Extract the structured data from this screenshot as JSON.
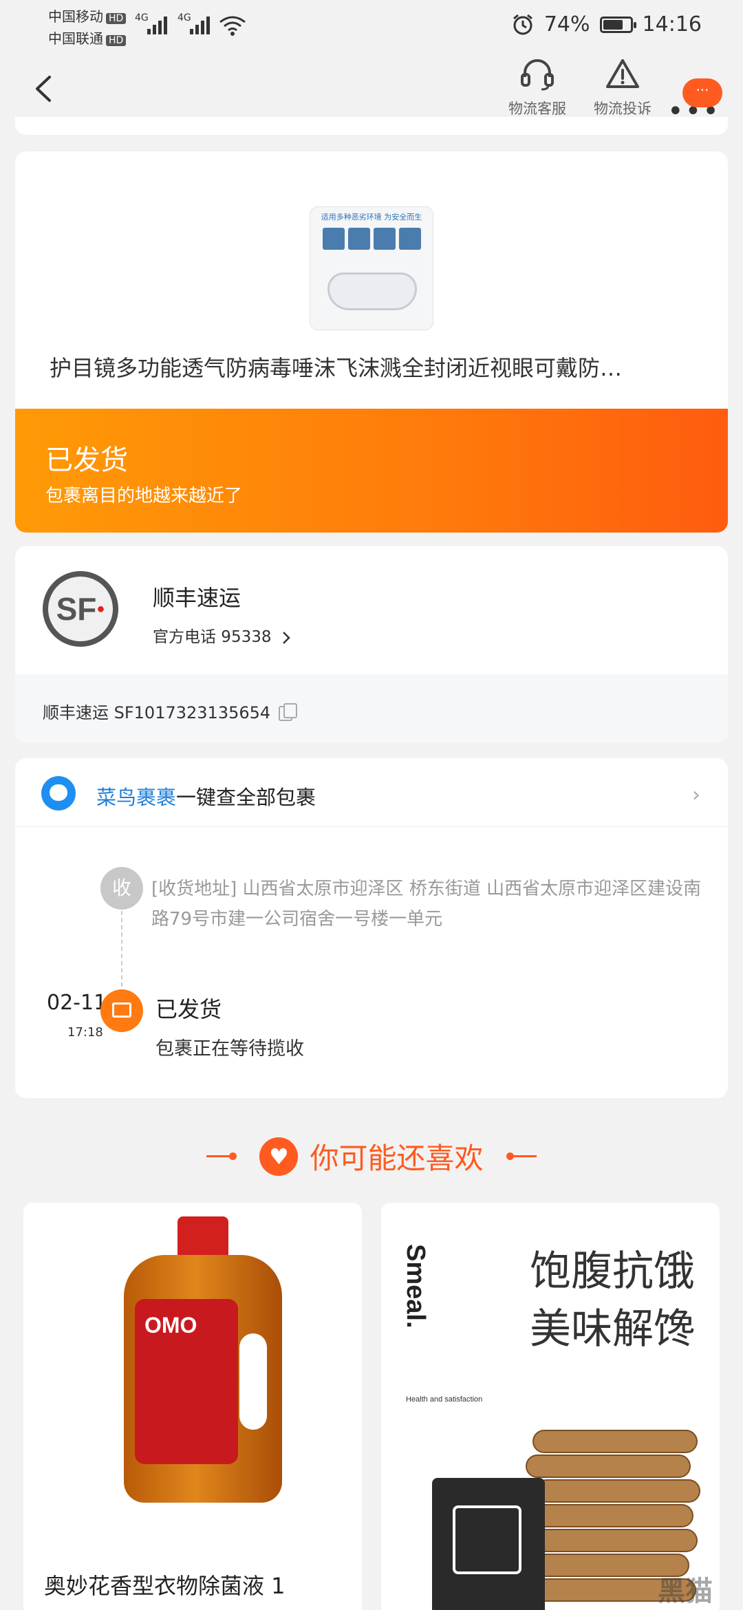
{
  "status_bar": {
    "carrier1": "中国移动",
    "carrier2": "中国联通",
    "hd": "HD",
    "network": "4G",
    "battery_text": "74%",
    "battery_level": 0.74,
    "time": "14:16"
  },
  "nav": {
    "service_label": "物流客服",
    "complaint_label": "物流投诉",
    "more_badge": "···"
  },
  "product": {
    "title": "护目镜多功能透气防病毒唾沫飞沫溅全封闭近视眼可戴防…",
    "image_banner": "适用多种恶劣环境 为安全而生"
  },
  "status": {
    "title": "已发货",
    "subtitle": "包裹离目的地越来越近了"
  },
  "courier": {
    "logo_text": "SF",
    "name": "顺丰速运",
    "phone_label": "官方电话 95338",
    "tracking_label": "顺丰速运 SF1017323135654"
  },
  "cainiao": {
    "brand": "菜鸟裹裹",
    "text": "一键查全部包裹",
    "chevron": "›"
  },
  "timeline": {
    "recv_icon": "收",
    "address": "[收货地址] 山西省太原市迎泽区 桥东街道 山西省太原市迎泽区建设南路79号市建一公司宿舍一号楼一单元",
    "event_date": "02-11",
    "event_time": "17:18",
    "event_title": "已发货",
    "event_desc": "包裹正在等待揽收"
  },
  "recommend": {
    "title": "你可能还喜欢",
    "items": [
      {
        "title": "奥妙花香型衣物除菌液 1",
        "brand": "OMO"
      },
      {
        "title_line1": "饱腹抗饿",
        "title_line2": "美味解馋",
        "brand": "Smeal.",
        "tagline": "Health and satisfaction"
      }
    ]
  },
  "watermark": "黑猫"
}
